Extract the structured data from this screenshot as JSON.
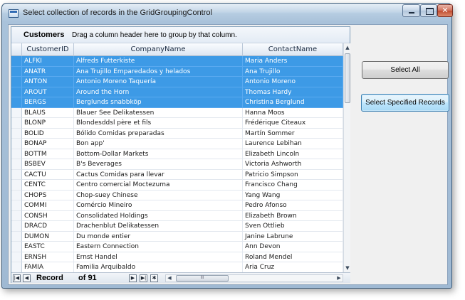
{
  "window": {
    "title": "Select collection of  records in the GridGroupingControl",
    "close_glyph": "✕"
  },
  "group_drop_area": {
    "title": "Customers",
    "hint": "Drag a column header here to group by that column."
  },
  "columns": [
    "CustomerID",
    "CompanyName",
    "ContactName"
  ],
  "rows": [
    {
      "id": "ALFKI",
      "company": "Alfreds Futterkiste",
      "contact": "Maria Anders",
      "selected": true
    },
    {
      "id": "ANATR",
      "company": "Ana Trujillo Emparedados y helados",
      "contact": "Ana Trujillo",
      "selected": true
    },
    {
      "id": "ANTON",
      "company": "Antonio Moreno Taquería",
      "contact": "Antonio Moreno",
      "selected": true
    },
    {
      "id": "AROUT",
      "company": "Around the Horn",
      "contact": "Thomas Hardy",
      "selected": true
    },
    {
      "id": "BERGS",
      "company": "Berglunds snabbköp",
      "contact": "Christina Berglund",
      "selected": true
    },
    {
      "id": "BLAUS",
      "company": "Blauer See Delikatessen",
      "contact": "Hanna Moos",
      "selected": false
    },
    {
      "id": "BLONP",
      "company": "Blondesddsl père et fils",
      "contact": "Frédérique Citeaux",
      "selected": false
    },
    {
      "id": "BOLID",
      "company": "Bólido Comidas preparadas",
      "contact": "Martín Sommer",
      "selected": false
    },
    {
      "id": "BONAP",
      "company": "Bon app'",
      "contact": "Laurence Lebihan",
      "selected": false
    },
    {
      "id": "BOTTM",
      "company": "Bottom-Dollar Markets",
      "contact": "Elizabeth Lincoln",
      "selected": false
    },
    {
      "id": "BSBEV",
      "company": "B's Beverages",
      "contact": "Victoria Ashworth",
      "selected": false
    },
    {
      "id": "CACTU",
      "company": "Cactus Comidas para llevar",
      "contact": "Patricio Simpson",
      "selected": false
    },
    {
      "id": "CENTC",
      "company": "Centro comercial Moctezuma",
      "contact": "Francisco Chang",
      "selected": false
    },
    {
      "id": "CHOPS",
      "company": "Chop-suey Chinese",
      "contact": "Yang Wang",
      "selected": false
    },
    {
      "id": "COMMI",
      "company": "Comércio Mineiro",
      "contact": "Pedro Afonso",
      "selected": false
    },
    {
      "id": "CONSH",
      "company": "Consolidated Holdings",
      "contact": "Elizabeth Brown",
      "selected": false
    },
    {
      "id": "DRACD",
      "company": "Drachenblut Delikatessen",
      "contact": "Sven Ottlieb",
      "selected": false
    },
    {
      "id": "DUMON",
      "company": "Du monde entier",
      "contact": "Janine Labrune",
      "selected": false
    },
    {
      "id": "EASTC",
      "company": "Eastern Connection",
      "contact": "Ann Devon",
      "selected": false
    },
    {
      "id": "ERNSH",
      "company": "Ernst Handel",
      "contact": "Roland Mendel",
      "selected": false
    },
    {
      "id": "FAMIA",
      "company": "Familia Arquibaldo",
      "contact": "Aria Cruz",
      "selected": false
    }
  ],
  "record_nav": {
    "record_label": "Record",
    "of_label": "of 91",
    "first_glyph": "|◀",
    "prev_glyph": "◀",
    "next_glyph": "▶",
    "last_glyph": "▶|",
    "new_glyph": "✱"
  },
  "scroll": {
    "up_glyph": "▲",
    "down_glyph": "▼",
    "left_glyph": "◀",
    "right_glyph": "▶",
    "thumb_grip": "III"
  },
  "buttons": {
    "select_all": "Select All",
    "select_specified": "Select Specified Records"
  },
  "colors": {
    "selection": "#3d9ae6",
    "window_frame": "#a9c2da"
  }
}
